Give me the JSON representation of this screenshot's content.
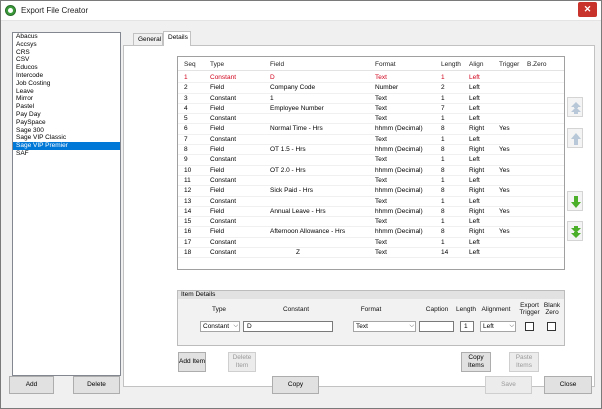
{
  "window": {
    "title": "Export File Creator",
    "close_glyph": "✕"
  },
  "formats": {
    "items": [
      "Abacus",
      "Accsys",
      "CRS",
      "CSV",
      "Educos",
      "Intercode",
      "Job Costing",
      "Leave",
      "Mirror",
      "Pastel",
      "Pay Day",
      "PaySpace",
      "Sage 300",
      "Sage VIP Classic",
      "Sage VIP Premier",
      "SAF"
    ],
    "selected": "Sage VIP Premier"
  },
  "tabs": [
    {
      "label": "General"
    },
    {
      "label": "Details"
    }
  ],
  "grid": {
    "columns": [
      "Seq",
      "Type",
      "Field",
      "Format",
      "Length",
      "Align",
      "Trigger",
      "B.Zero"
    ],
    "rows": [
      [
        "1",
        "Constant",
        "D",
        "Text",
        "1",
        "Left",
        "",
        ""
      ],
      [
        "2",
        "Field",
        "Company Code",
        "Number",
        "2",
        "Left",
        "",
        ""
      ],
      [
        "3",
        "Constant",
        "1",
        "Text",
        "1",
        "Left",
        "",
        ""
      ],
      [
        "4",
        "Field",
        "Employee Number",
        "Text",
        "7",
        "Left",
        "",
        ""
      ],
      [
        "5",
        "Constant",
        "",
        "Text",
        "1",
        "Left",
        "",
        ""
      ],
      [
        "6",
        "Field",
        "Normal Time - Hrs",
        "hhmm (Decimal)",
        "8",
        "Right",
        "Yes",
        ""
      ],
      [
        "7",
        "Constant",
        "",
        "Text",
        "1",
        "Left",
        "",
        ""
      ],
      [
        "8",
        "Field",
        "OT 1.5 - Hrs",
        "hhmm (Decimal)",
        "8",
        "Right",
        "Yes",
        ""
      ],
      [
        "9",
        "Constant",
        "",
        "Text",
        "1",
        "Left",
        "",
        ""
      ],
      [
        "10",
        "Field",
        "OT 2.0 - Hrs",
        "hhmm (Decimal)",
        "8",
        "Right",
        "Yes",
        ""
      ],
      [
        "11",
        "Constant",
        "",
        "Text",
        "1",
        "Left",
        "",
        ""
      ],
      [
        "12",
        "Field",
        "Sick Paid - Hrs",
        "hhmm (Decimal)",
        "8",
        "Right",
        "Yes",
        ""
      ],
      [
        "13",
        "Constant",
        "",
        "Text",
        "1",
        "Left",
        "",
        ""
      ],
      [
        "14",
        "Field",
        "Annual Leave - Hrs",
        "hhmm (Decimal)",
        "8",
        "Right",
        "Yes",
        ""
      ],
      [
        "15",
        "Constant",
        "",
        "Text",
        "1",
        "Left",
        "",
        ""
      ],
      [
        "16",
        "Field",
        "Afternoon Allowance - Hrs",
        "hhmm (Decimal)",
        "8",
        "Right",
        "Yes",
        ""
      ],
      [
        "17",
        "Constant",
        "",
        "Text",
        "1",
        "Left",
        "",
        ""
      ],
      [
        "18",
        "Constant",
        "Z",
        "Text",
        "14",
        "Left",
        "",
        ""
      ]
    ],
    "highlight_row": 0,
    "highlight_color": "#d0021b"
  },
  "move_buttons": {
    "top_icon": "double-up-arrow-icon",
    "up_icon": "up-arrow-icon",
    "down_icon": "down-arrow-icon",
    "bottom_icon": "double-down-arrow-icon",
    "active_color": "#4caf2a",
    "disabled_color": "#b8c8d8"
  },
  "item_details": {
    "title": "Item Details",
    "labels": {
      "type": "Type",
      "constant": "Constant",
      "format": "Format",
      "caption": "Caption",
      "length": "Length",
      "alignment": "Alignment",
      "export_trigger": "Export Trigger",
      "blank_zero": "Blank Zero"
    },
    "values": {
      "type": "Constant",
      "constant": "D",
      "format": "Text",
      "caption": "",
      "length": "1",
      "alignment": "Left",
      "export_trigger": false,
      "blank_zero": false
    }
  },
  "panel_buttons": {
    "add_item": "Add Item",
    "delete_item": "Delete Item",
    "copy_items": "Copy Items",
    "paste_items": "Paste Items"
  },
  "footer_buttons": {
    "add": "Add",
    "delete": "Delete",
    "copy": "Copy",
    "save": "Save",
    "close": "Close"
  }
}
